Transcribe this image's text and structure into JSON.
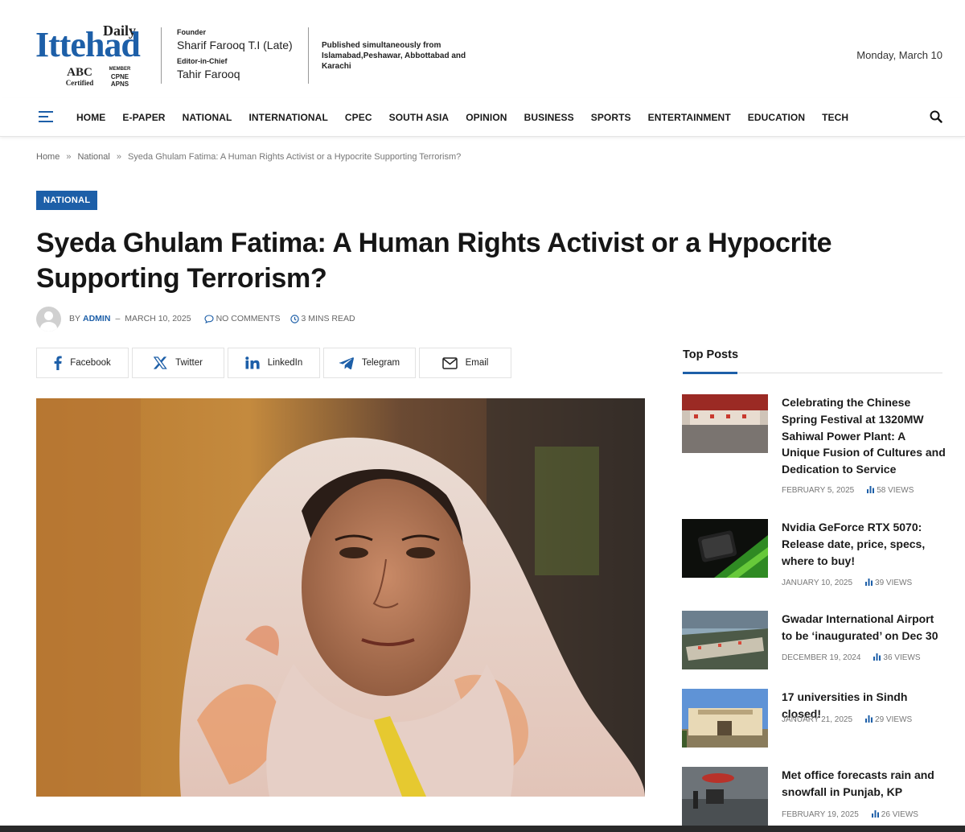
{
  "header": {
    "logo": {
      "daily": "Daily",
      "name": "Ittehad",
      "abc_big": "ABC",
      "abc_small": "Certified",
      "member": "MEMBER",
      "cpne": "CPNE",
      "apns": "APNS"
    },
    "founder_label": "Founder",
    "founder_name": "Sharif Farooq T.I (Late)",
    "editor_label": "Editor-in-Chief",
    "editor_name": "Tahir Farooq",
    "published": "Published simultaneously from Islamabad,Peshawar, Abbottabad and Karachi",
    "date": "Monday, March 10"
  },
  "nav": {
    "items": [
      "HOME",
      "E-PAPER",
      "NATIONAL",
      "INTERNATIONAL",
      "CPEC",
      "SOUTH ASIA",
      "OPINION",
      "BUSINESS",
      "SPORTS",
      "ENTERTAINMENT",
      "EDUCATION",
      "TECH"
    ]
  },
  "breadcrumb": {
    "home": "Home",
    "sep": "»",
    "category": "National",
    "current": "Syeda Ghulam Fatima: A Human Rights Activist or a Hypocrite Supporting Terrorism?"
  },
  "article": {
    "category": "NATIONAL",
    "title": "Syeda Ghulam Fatima: A Human Rights Activist or a Hypocrite Supporting Terrorism?",
    "by": "BY",
    "author": "ADMIN",
    "dash": "–",
    "date": "MARCH 10, 2025",
    "comments": "NO COMMENTS",
    "read_time": "3 MINS READ"
  },
  "share": {
    "facebook": "Facebook",
    "twitter": "Twitter",
    "linkedin": "LinkedIn",
    "telegram": "Telegram",
    "email": "Email"
  },
  "sidebar": {
    "heading": "Top Posts",
    "posts": [
      {
        "title": "Celebrating the Chinese Spring Festival at 1320MW Sahiwal Power Plant: A Unique Fusion of Cultures and Dedication to Service",
        "date": "FEBRUARY 5, 2025",
        "views": "58 VIEWS"
      },
      {
        "title": "Nvidia GeForce RTX 5070: Release date, price, specs, where to buy!",
        "date": "JANUARY 10, 2025",
        "views": "39 VIEWS"
      },
      {
        "title": "Gwadar International Airport to be ‘inaugurated’ on Dec 30",
        "date": "DECEMBER 19, 2024",
        "views": "36 VIEWS"
      },
      {
        "title": "17 universities in Sindh closed!",
        "date": "JANUARY 21, 2025",
        "views": "29 VIEWS"
      },
      {
        "title": "Met office forecasts rain and snowfall in Punjab, KP",
        "date": "FEBRUARY 19, 2025",
        "views": "26 VIEWS"
      }
    ]
  },
  "colors": {
    "accent": "#1d5fa8",
    "text": "#161616",
    "muted": "#777777"
  }
}
